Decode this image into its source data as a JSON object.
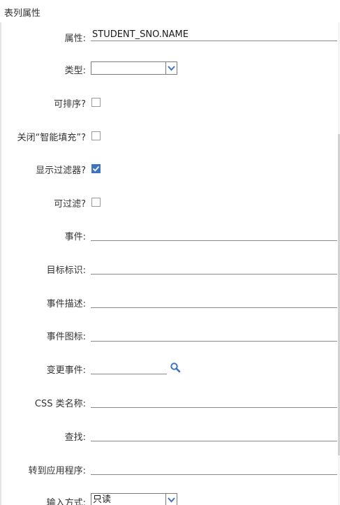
{
  "panel": {
    "title": "表列属性"
  },
  "fields": {
    "attribute": {
      "label": "属性:",
      "value": "STUDENT_SNO.NAME"
    },
    "type": {
      "label": "类型:",
      "value": ""
    },
    "sortable": {
      "label": "可排序?",
      "checked": false
    },
    "disable_autofill": {
      "label": "关闭“智能填充”?",
      "checked": false
    },
    "show_filter": {
      "label": "显示过滤器?",
      "checked": true
    },
    "filterable": {
      "label": "可过滤?",
      "checked": false
    },
    "event": {
      "label": "事件:",
      "value": ""
    },
    "target_id": {
      "label": "目标标识:",
      "value": ""
    },
    "event_desc": {
      "label": "事件描述:",
      "value": ""
    },
    "event_icon": {
      "label": "事件图标:",
      "value": ""
    },
    "change_event": {
      "label": "变更事件:",
      "value": "",
      "icon": "search-icon"
    },
    "css_class": {
      "label": "CSS 类名称:",
      "value": ""
    },
    "lookup": {
      "label": "查找:",
      "value": ""
    },
    "goto_app": {
      "label": "转到应用程序:",
      "value": ""
    },
    "input_mode": {
      "label": "输入方式:",
      "value": "只读"
    }
  },
  "colors": {
    "checkbox_checked": "#3c74c2",
    "dropdown_chevron": "#3c74c2",
    "search_icon": "#3c74c2"
  }
}
